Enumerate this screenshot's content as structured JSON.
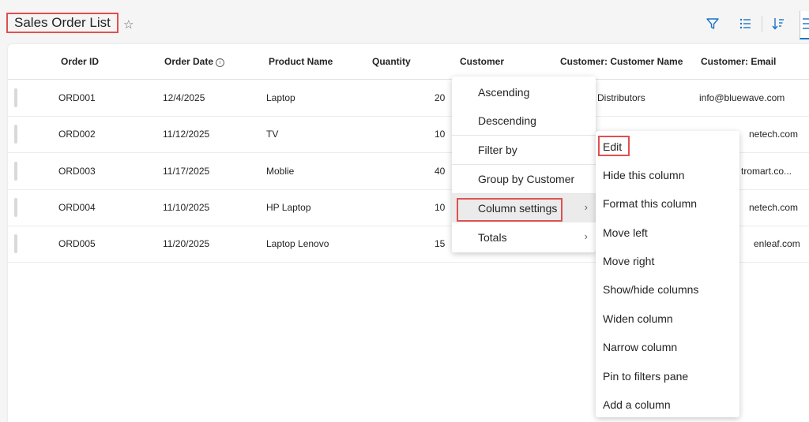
{
  "header": {
    "title": "Sales Order List",
    "favorite_icon": "star-outline-icon",
    "toolbar_icons": [
      "filter-icon",
      "list-icon",
      "sort-icon",
      "list-view-icon"
    ],
    "accent_color": "#1a73c8",
    "highlight_color": "#e05050"
  },
  "table": {
    "columns": [
      "Order ID",
      "Order Date",
      "Product Name",
      "Quantity",
      "Customer",
      "Customer: Customer Name",
      "Customer: Email"
    ],
    "rows": [
      {
        "order_id": "ORD001",
        "order_date": "12/4/2025",
        "product": "Laptop",
        "quantity": "20",
        "customer_name": "e Distributors",
        "email": "info@bluewave.com"
      },
      {
        "order_id": "ORD002",
        "order_date": "11/12/2025",
        "product": "TV",
        "quantity": "10",
        "customer_name": "",
        "email": "netech.com"
      },
      {
        "order_id": "ORD003",
        "order_date": "11/17/2025",
        "product": "Moblie",
        "quantity": "40",
        "customer_name": "",
        "email": "tromart.co..."
      },
      {
        "order_id": "ORD004",
        "order_date": "11/10/2025",
        "product": "HP Laptop",
        "quantity": "10",
        "customer_name": "",
        "email": "netech.com"
      },
      {
        "order_id": "ORD005",
        "order_date": "11/20/2025",
        "product": "Laptop Lenovo",
        "quantity": "15",
        "customer_name": "",
        "email": "enleaf.com"
      }
    ]
  },
  "context_menu": {
    "items": [
      {
        "label": "Ascending"
      },
      {
        "label": "Descending"
      },
      {
        "label": "Filter by"
      },
      {
        "label": "Group by Customer"
      },
      {
        "label": "Column settings"
      },
      {
        "label": "Totals"
      }
    ],
    "chevron": "›"
  },
  "submenu": {
    "items": [
      {
        "label": "Edit"
      },
      {
        "label": "Hide this column"
      },
      {
        "label": "Format this column"
      },
      {
        "label": "Move left"
      },
      {
        "label": "Move right"
      },
      {
        "label": "Show/hide columns"
      },
      {
        "label": "Widen column"
      },
      {
        "label": "Narrow column"
      },
      {
        "label": "Pin to filters pane"
      },
      {
        "label": "Add a column"
      }
    ]
  }
}
